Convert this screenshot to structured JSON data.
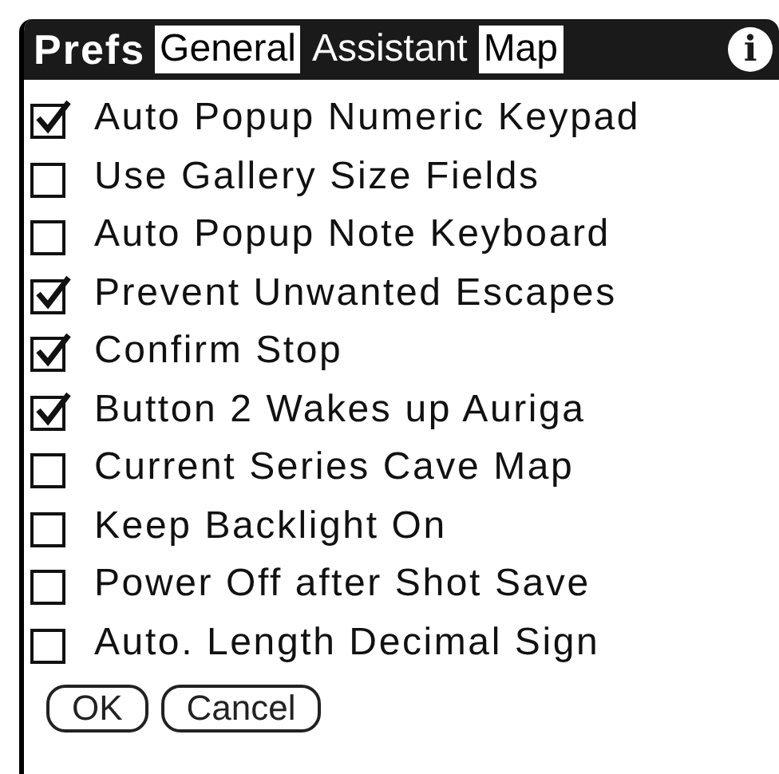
{
  "title_bar": {
    "title": "Prefs",
    "tabs": [
      {
        "label": "General",
        "selected": false
      },
      {
        "label": "Assistant",
        "selected": true
      },
      {
        "label": "Map",
        "selected": false
      }
    ],
    "info_icon": "i"
  },
  "options": [
    {
      "label": "Auto Popup Numeric Keypad",
      "checked": true
    },
    {
      "label": "Use Gallery Size Fields",
      "checked": false
    },
    {
      "label": "Auto Popup Note Keyboard",
      "checked": false
    },
    {
      "label": "Prevent Unwanted Escapes",
      "checked": true
    },
    {
      "label": "Confirm Stop",
      "checked": true
    },
    {
      "label": "Button 2 Wakes up Auriga",
      "checked": true
    },
    {
      "label": "Current Series Cave Map",
      "checked": false
    },
    {
      "label": "Keep Backlight On",
      "checked": false
    },
    {
      "label": "Power Off after Shot Save",
      "checked": false
    },
    {
      "label": "Auto. Length Decimal Sign",
      "checked": false
    }
  ],
  "buttons": [
    "OK",
    "Cancel"
  ]
}
